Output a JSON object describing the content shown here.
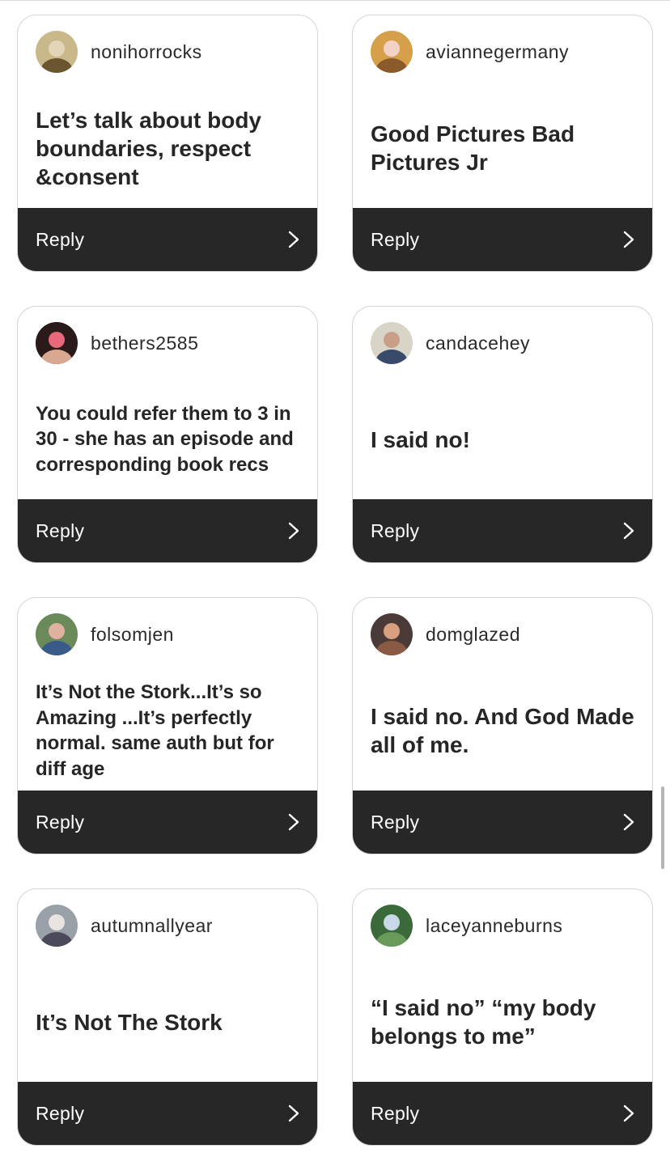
{
  "cards": [
    {
      "username": "nonihorrocks",
      "text": "Let’s talk about body boundaries, respect &consent",
      "reply_label": "Reply",
      "size": "large",
      "avatar_colors": [
        "#c9b98a",
        "#6a5530",
        "#e3d6b8"
      ]
    },
    {
      "username": "aviannegermany",
      "text": "Good Pictures Bad Pictures Jr",
      "reply_label": "Reply",
      "size": "large",
      "avatar_colors": [
        "#d6a04a",
        "#8a5a2a",
        "#f2d2c4"
      ]
    },
    {
      "username": "bethers2585",
      "text": "You could refer them to 3 in 30 - she has an episode and corresponding book recs",
      "reply_label": "Reply",
      "size": "medium",
      "avatar_colors": [
        "#2a1a1a",
        "#d8a890",
        "#e86a7a"
      ]
    },
    {
      "username": "candacehey",
      "text": "I said no!",
      "reply_label": "Reply",
      "size": "large",
      "avatar_colors": [
        "#d9d4c8",
        "#3a4a6a",
        "#c8a088"
      ]
    },
    {
      "username": "folsomjen",
      "text": "It’s Not the Stork...It’s so Amazing ...It’s perfectly normal.  same auth but for diff age",
      "reply_label": "Reply",
      "size": "medium",
      "avatar_colors": [
        "#6a8a5a",
        "#3a5a8a",
        "#e0b0a0"
      ]
    },
    {
      "username": "domglazed",
      "text": "I said no. And God Made all of me.",
      "reply_label": "Reply",
      "size": "large",
      "avatar_colors": [
        "#4a3a38",
        "#8a5a44",
        "#d8a080"
      ]
    },
    {
      "username": "autumnallyear",
      "text": "It’s Not The Stork",
      "reply_label": "Reply",
      "size": "large",
      "avatar_colors": [
        "#9aa0a8",
        "#4a4a5a",
        "#e8e4e0"
      ]
    },
    {
      "username": "laceyanneburns",
      "text": "“I said no” “my body belongs to me”",
      "reply_label": "Reply",
      "size": "large",
      "avatar_colors": [
        "#3a6a3a",
        "#6a9a5a",
        "#c8d8e8"
      ]
    }
  ],
  "icons": {
    "reply_arrow": "chevron-right-icon"
  },
  "colors": {
    "reply_bar": "#272727",
    "card_border": "#d6d6d6",
    "text": "#262626"
  }
}
